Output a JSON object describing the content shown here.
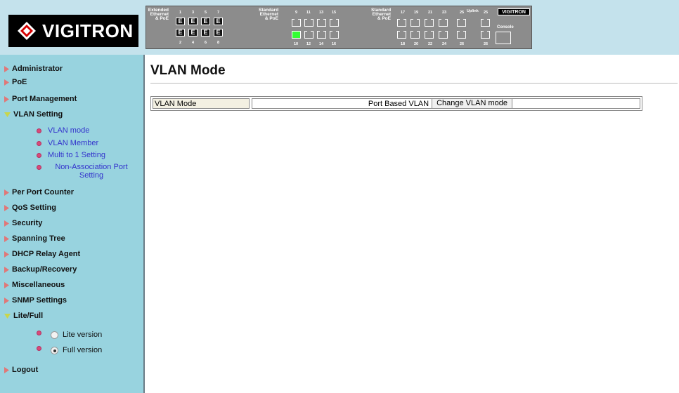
{
  "brand": {
    "logo_text": "VIGITRON",
    "mini_logo_text": "VIGITRON"
  },
  "switch_panel": {
    "group1_label": [
      "Extended",
      "Ethernet",
      "& PoE"
    ],
    "group2_label": [
      "Standard",
      "Ethernet",
      "& PoE"
    ],
    "group3_label": [
      "Standard",
      "Ethernet",
      "& PoE"
    ],
    "uplink_label": "Uplink",
    "console_label": "Console",
    "top_numbers": [
      "1",
      "3",
      "5",
      "7",
      "9",
      "11",
      "13",
      "15",
      "17",
      "19",
      "21",
      "23",
      "25",
      "25"
    ],
    "bottom_numbers": [
      "2",
      "4",
      "6",
      "8",
      "10",
      "12",
      "14",
      "16",
      "18",
      "20",
      "22",
      "24",
      "26",
      "26"
    ],
    "active_port": "10"
  },
  "sidebar": {
    "items": [
      {
        "label": "Administrator",
        "expanded": false
      },
      {
        "label": "PoE",
        "expanded": false
      },
      {
        "label": "Port Management",
        "expanded": false
      },
      {
        "label": "VLAN Setting",
        "expanded": true
      },
      {
        "label": "Per Port Counter",
        "expanded": false
      },
      {
        "label": "QoS Setting",
        "expanded": false
      },
      {
        "label": "Security",
        "expanded": false
      },
      {
        "label": "Spanning Tree",
        "expanded": false
      },
      {
        "label": "DHCP Relay Agent",
        "expanded": false
      },
      {
        "label": "Backup/Recovery",
        "expanded": false
      },
      {
        "label": "Miscellaneous",
        "expanded": false
      },
      {
        "label": "SNMP Settings",
        "expanded": false
      },
      {
        "label": "Lite/Full",
        "expanded": true
      },
      {
        "label": "Logout",
        "expanded": false
      }
    ],
    "vlan_sub": [
      {
        "label": "VLAN mode"
      },
      {
        "label": "VLAN Member"
      },
      {
        "label": "Multi to 1 Setting"
      },
      {
        "label": "Non-Association Port Setting"
      }
    ],
    "lite_full": {
      "options": [
        {
          "label": "Lite version",
          "checked": false
        },
        {
          "label": "Full version",
          "checked": true
        }
      ]
    }
  },
  "main": {
    "title": "VLAN Mode",
    "vlan_mode_label": "VLAN Mode",
    "vlan_mode_value": "Port Based VLAN",
    "change_button": "Change VLAN mode"
  },
  "colors": {
    "sidebar_bg": "#98d3df",
    "header_bg": "#c4e2ec",
    "arrow_collapsed": "#e07878",
    "arrow_expanded": "#c9d64a",
    "submenu_link": "#3333cc"
  }
}
